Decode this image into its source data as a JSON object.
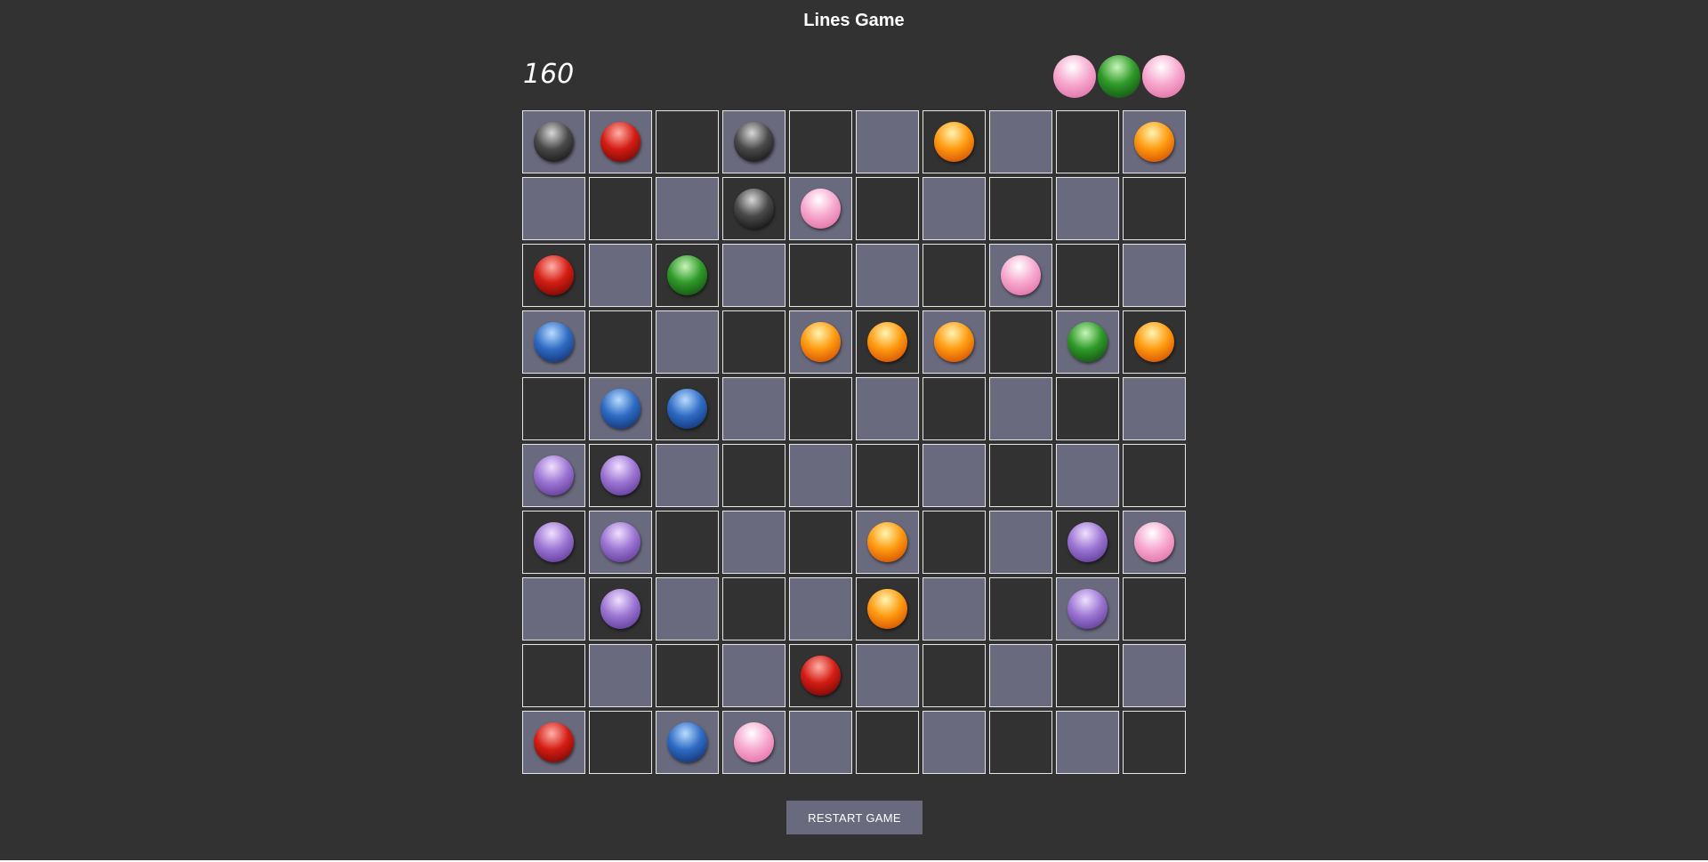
{
  "app": {
    "title": "Lines Game",
    "score": "160",
    "restart_label": "RESTART GAME"
  },
  "colors": {
    "background": "#323232",
    "cell_light": "#6a6a7e",
    "cell_dark": "#323232",
    "cell_border": "#e6e6e6",
    "button": "#6a6a7e"
  },
  "ball_colors": {
    "K": {
      "name": "black",
      "hi": "#d8d8d8",
      "mid": "#4a4a4a",
      "dark": "#070707"
    },
    "R": {
      "name": "red",
      "hi": "#ffb0a8",
      "mid": "#d41d14",
      "dark": "#5a0300"
    },
    "O": {
      "name": "orange",
      "hi": "#fff4b0",
      "mid": "#ff9a10",
      "dark": "#c53a00"
    },
    "P": {
      "name": "pink",
      "hi": "#ffffff",
      "mid": "#f7a9cf",
      "dark": "#d9619a"
    },
    "G": {
      "name": "green",
      "hi": "#c8f5b8",
      "mid": "#2f9a2a",
      "dark": "#0c3d0a"
    },
    "B": {
      "name": "blue",
      "hi": "#b8dcff",
      "mid": "#2f6cc4",
      "dark": "#0a245e"
    },
    "V": {
      "name": "purple",
      "hi": "#f0e0ff",
      "mid": "#9d76d4",
      "dark": "#4e2a85"
    }
  },
  "next_balls": [
    "P",
    "G",
    "P"
  ],
  "board": {
    "cells": [
      [
        "light:K",
        "light:R",
        "dark:",
        "light:K",
        "dark:",
        "light:",
        "dark:O",
        "light:",
        "dark:",
        "light:O"
      ],
      [
        "light:",
        "dark:",
        "light:",
        "dark:K",
        "light:P",
        "dark:",
        "light:",
        "dark:",
        "light:",
        "dark:"
      ],
      [
        "dark:R",
        "light:",
        "dark:G",
        "light:",
        "dark:",
        "light:",
        "dark:",
        "light:P",
        "dark:",
        "light:"
      ],
      [
        "light:B",
        "dark:",
        "light:",
        "dark:",
        "light:O",
        "dark:O",
        "light:O",
        "dark:",
        "light:G",
        "dark:O"
      ],
      [
        "dark:",
        "light:B",
        "dark:B",
        "light:",
        "dark:",
        "light:",
        "dark:",
        "light:",
        "dark:",
        "light:"
      ],
      [
        "light:V",
        "dark:V",
        "light:",
        "dark:",
        "light:",
        "dark:",
        "light:",
        "dark:",
        "light:",
        "dark:"
      ],
      [
        "dark:V",
        "light:V",
        "dark:",
        "light:",
        "dark:",
        "light:O",
        "dark:",
        "light:",
        "dark:V",
        "light:P"
      ],
      [
        "light:",
        "dark:V",
        "light:",
        "dark:",
        "light:",
        "dark:O",
        "light:",
        "dark:",
        "light:V",
        "dark:"
      ],
      [
        "dark:",
        "light:",
        "dark:",
        "light:",
        "dark:R",
        "light:",
        "dark:",
        "light:",
        "dark:",
        "light:"
      ],
      [
        "light:R",
        "dark:",
        "light:B",
        "light:P",
        "light:",
        "dark:",
        "light:",
        "dark:",
        "light:",
        "dark:"
      ]
    ]
  }
}
